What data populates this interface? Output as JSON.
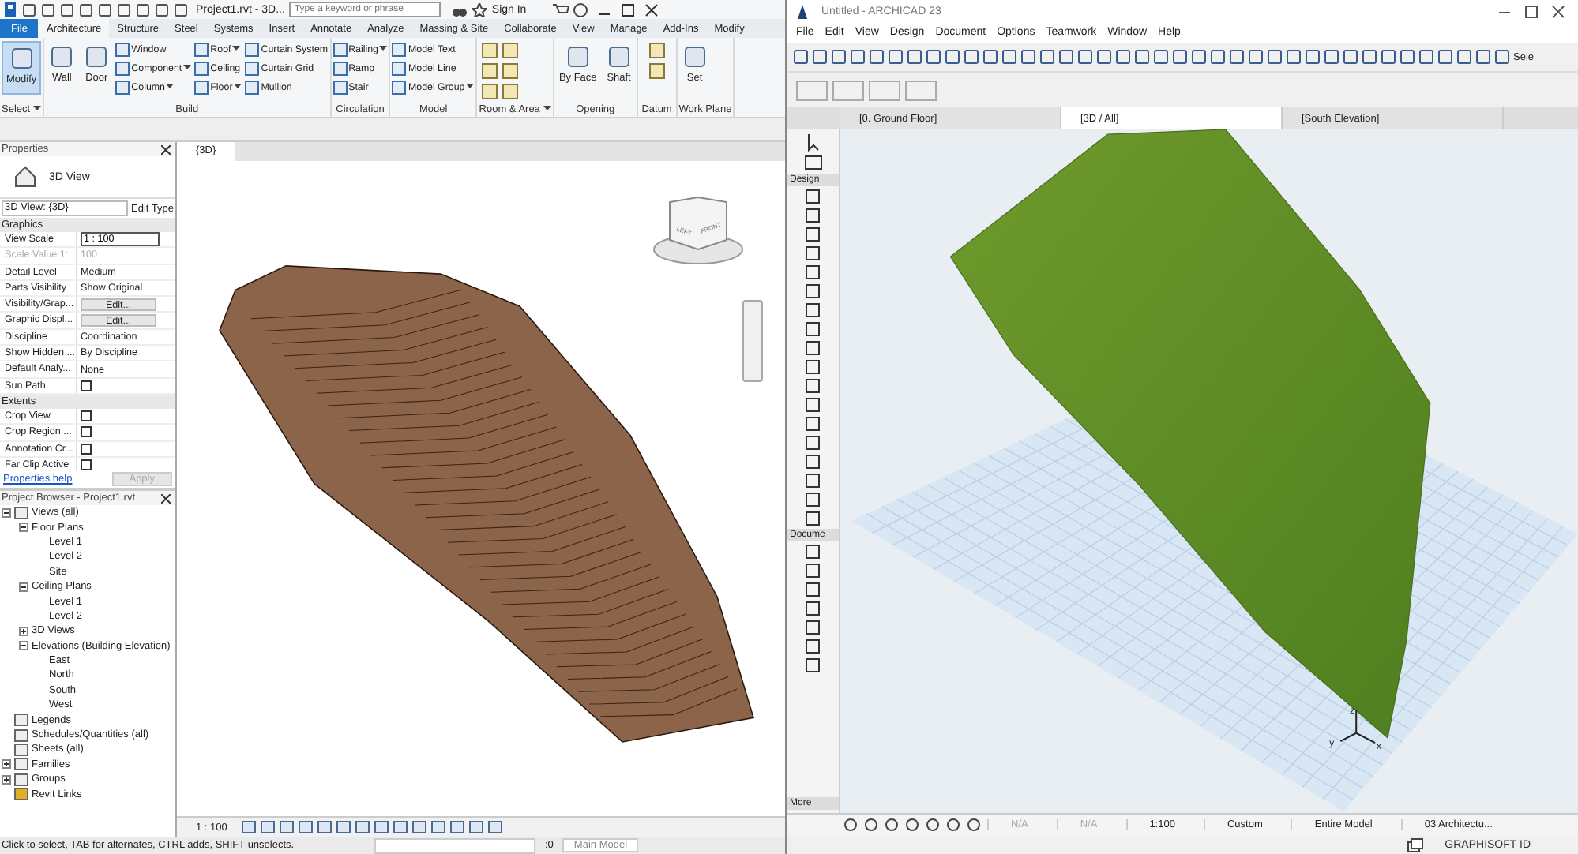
{
  "revit": {
    "quick_access": {
      "title": "Project1.rvt - 3D...",
      "search": {
        "placeholder": "Type a keyword or phrase"
      },
      "sign_in": "Sign In"
    },
    "ribbon_tabs": [
      {
        "label": "File",
        "kind": "file",
        "selected": false
      },
      {
        "label": "Architecture",
        "kind": "tab",
        "selected": true
      },
      {
        "label": "Structure",
        "kind": "tab",
        "selected": false
      },
      {
        "label": "Steel",
        "kind": "tab",
        "selected": false
      },
      {
        "label": "Systems",
        "kind": "tab",
        "selected": false
      },
      {
        "label": "Insert",
        "kind": "tab",
        "selected": false
      },
      {
        "label": "Annotate",
        "kind": "tab",
        "selected": false
      },
      {
        "label": "Analyze",
        "kind": "tab",
        "selected": false
      },
      {
        "label": "Massing & Site",
        "kind": "tab",
        "selected": false
      },
      {
        "label": "Collaborate",
        "kind": "tab",
        "selected": false
      },
      {
        "label": "View",
        "kind": "tab",
        "selected": false
      },
      {
        "label": "Manage",
        "kind": "tab",
        "selected": false
      },
      {
        "label": "Add-Ins",
        "kind": "tab",
        "selected": false
      },
      {
        "label": "Modify",
        "kind": "tab",
        "selected": false
      }
    ],
    "ribbon_panels": [
      {
        "title": "Select",
        "menu": true,
        "kind": "buttons",
        "large": [
          {
            "label": "Modify",
            "active": true
          }
        ]
      },
      {
        "title": "Build",
        "menu": false,
        "kind": "buttons",
        "large": [
          {
            "label": "Wall",
            "active": false
          },
          {
            "label": "Door",
            "active": false
          }
        ],
        "columns": [
          [
            {
              "label": "Window",
              "dropdown": false
            },
            {
              "label": "Component",
              "dropdown": true
            },
            {
              "label": "Column",
              "dropdown": true
            }
          ],
          [
            {
              "label": "Roof",
              "dropdown": true
            },
            {
              "label": "Ceiling",
              "dropdown": false
            },
            {
              "label": "Floor",
              "dropdown": true
            }
          ],
          [
            {
              "label": "Curtain System",
              "dropdown": false
            },
            {
              "label": "Curtain Grid",
              "dropdown": false
            },
            {
              "label": "Mullion",
              "dropdown": false
            }
          ]
        ]
      },
      {
        "title": "Circulation",
        "menu": false,
        "kind": "buttons",
        "columns": [
          [
            {
              "label": "Railing",
              "dropdown": true
            },
            {
              "label": "Ramp",
              "dropdown": false
            },
            {
              "label": "Stair",
              "dropdown": false
            }
          ]
        ]
      },
      {
        "title": "Model",
        "menu": false,
        "kind": "buttons",
        "columns": [
          [
            {
              "label": "Model Text",
              "dropdown": false
            },
            {
              "label": "Model Line",
              "dropdown": false
            },
            {
              "label": "Model Group",
              "dropdown": true
            }
          ]
        ]
      },
      {
        "title": "Room & Area",
        "menu": true,
        "kind": "icons"
      },
      {
        "title": "Opening",
        "menu": false,
        "kind": "buttons",
        "large": [
          {
            "label": "By Face",
            "active": false
          },
          {
            "label": "Shaft",
            "active": false
          }
        ]
      },
      {
        "title": "Datum",
        "menu": false,
        "kind": "icons"
      },
      {
        "title": "Work Plane",
        "menu": false,
        "kind": "buttons",
        "large": [
          {
            "label": "Set",
            "active": false
          }
        ]
      }
    ],
    "properties": {
      "title": "Properties",
      "type_name": "3D View",
      "selector": "3D View: {3D}",
      "edit_type": "Edit Type",
      "groups": [
        {
          "title": "Graphics",
          "rows": [
            {
              "label": "View Scale",
              "kind": "input",
              "value": "1 : 100",
              "disabled": false
            },
            {
              "label": "Scale Value    1:",
              "kind": "text",
              "value": "100",
              "disabled": true
            },
            {
              "label": "Detail Level",
              "kind": "text",
              "value": "Medium",
              "disabled": false
            },
            {
              "label": "Parts Visibility",
              "kind": "text",
              "value": "Show Original",
              "disabled": false
            },
            {
              "label": "Visibility/Grap...",
              "kind": "button",
              "value": "Edit...",
              "disabled": false
            },
            {
              "label": "Graphic Displ...",
              "kind": "button",
              "value": "Edit...",
              "disabled": false
            },
            {
              "label": "Discipline",
              "kind": "text",
              "value": "Coordination",
              "disabled": false
            },
            {
              "label": "Show Hidden ...",
              "kind": "text",
              "value": "By Discipline",
              "disabled": false
            },
            {
              "label": "Default Analy...",
              "kind": "text",
              "value": "None",
              "disabled": false
            },
            {
              "label": "Sun Path",
              "kind": "checkbox",
              "checked": false,
              "disabled": false
            }
          ]
        },
        {
          "title": "Extents",
          "rows": [
            {
              "label": "Crop View",
              "kind": "checkbox",
              "checked": false,
              "disabled": false
            },
            {
              "label": "Crop Region ...",
              "kind": "checkbox",
              "checked": false,
              "disabled": false
            },
            {
              "label": "Annotation Cr...",
              "kind": "checkbox",
              "checked": false,
              "disabled": false
            },
            {
              "label": "Far Clip Active",
              "kind": "checkbox",
              "checked": false,
              "disabled": false
            }
          ]
        }
      ],
      "help": "Properties help",
      "apply": {
        "label": "Apply",
        "disabled": true
      }
    },
    "browser": {
      "title": "Project Browser - Project1.rvt",
      "tree": [
        {
          "label": "Views (all)",
          "kind": "views",
          "expanded": true,
          "children": [
            {
              "label": "Floor Plans",
              "expanded": true,
              "children": [
                {
                  "label": "Level 1"
                },
                {
                  "label": "Level 2"
                },
                {
                  "label": "Site"
                }
              ]
            },
            {
              "label": "Ceiling Plans",
              "expanded": true,
              "children": [
                {
                  "label": "Level 1"
                },
                {
                  "label": "Level 2"
                }
              ]
            },
            {
              "label": "3D Views",
              "expanded": false
            },
            {
              "label": "Elevations (Building Elevation)",
              "expanded": true,
              "children": [
                {
                  "label": "East"
                },
                {
                  "label": "North"
                },
                {
                  "label": "South"
                },
                {
                  "label": "West"
                }
              ]
            }
          ]
        },
        {
          "label": "Legends",
          "kind": "legend"
        },
        {
          "label": "Schedules/Quantities (all)",
          "kind": "schedule"
        },
        {
          "label": "Sheets (all)",
          "kind": "sheet"
        },
        {
          "label": "Families",
          "kind": "family",
          "expanded": false
        },
        {
          "label": "Groups",
          "kind": "groups",
          "expanded": false
        },
        {
          "label": "Revit Links",
          "kind": "link"
        }
      ]
    },
    "view": {
      "tab": "{3D}",
      "viewcube": [
        "LEFT",
        "FRONT"
      ],
      "scale": "1 : 100"
    },
    "status": {
      "message": "Click to select, TAB for alternates, CTRL adds, SHIFT unselects.",
      "filter_count": ":0",
      "model": "Main Model"
    }
  },
  "archicad": {
    "title": "Untitled - ARCHICAD 23",
    "menu": [
      "File",
      "Edit",
      "View",
      "Design",
      "Document",
      "Options",
      "Teamwork",
      "Window",
      "Help"
    ],
    "toolbar_cut_label": "Sele",
    "tabs": [
      {
        "label": "[0. Ground Floor]",
        "selected": false
      },
      {
        "label": "[3D / All]",
        "selected": true
      },
      {
        "label": "[South Elevation]",
        "selected": false
      }
    ],
    "toolbox_sections": [
      {
        "title": "Design",
        "kind": "design"
      },
      {
        "title": "Docume",
        "kind": "document"
      }
    ],
    "toolbox_more": "More",
    "axes": [
      "z",
      "y",
      "x"
    ],
    "nav_fields": [
      {
        "value": "N/A",
        "disabled": true
      },
      {
        "value": "N/A",
        "disabled": true
      },
      {
        "value": "1:100",
        "disabled": false
      },
      {
        "value": "Custom",
        "disabled": false
      },
      {
        "value": "Entire Model",
        "disabled": false
      },
      {
        "value": "03 Architectu...",
        "disabled": false
      }
    ],
    "graphisoft_id": "GRAPHISOFT ID"
  }
}
